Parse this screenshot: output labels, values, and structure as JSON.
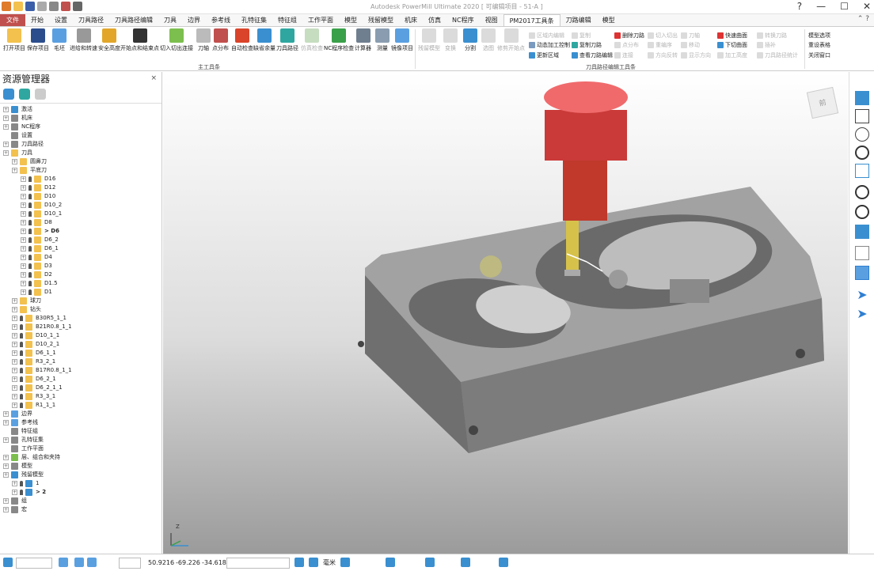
{
  "window": {
    "title": "Autodesk PowerMill Ultimate 2020  [ 可编辑项目 - 51-A ]",
    "help_glyph": "?",
    "min_glyph": "—",
    "max_glyph": "☐",
    "close_glyph": "✕"
  },
  "ribbon_tabs": [
    {
      "label": "文件"
    },
    {
      "label": "开始"
    },
    {
      "label": "设置"
    },
    {
      "label": "刀具路径"
    },
    {
      "label": "刀具路径编辑"
    },
    {
      "label": "刀具"
    },
    {
      "label": "边界"
    },
    {
      "label": "参考线"
    },
    {
      "label": "孔特征集"
    },
    {
      "label": "特征组"
    },
    {
      "label": "工作平面"
    },
    {
      "label": "模型"
    },
    {
      "label": "残留模型"
    },
    {
      "label": "机床"
    },
    {
      "label": "仿真"
    },
    {
      "label": "NC程序"
    },
    {
      "label": "视图"
    },
    {
      "label": "PM2017工具条"
    },
    {
      "label": "刀路编辑"
    },
    {
      "label": "模型"
    }
  ],
  "ribbon": {
    "group_main_label": "主工具条",
    "group_edit_label": "刀具路径编辑工具条",
    "main_buttons": [
      {
        "label": "打开项目"
      },
      {
        "label": "保存项目"
      },
      {
        "label": "毛坯"
      },
      {
        "label": "进给和转速"
      },
      {
        "label": "安全高度"
      },
      {
        "label": "开始点和结束点"
      },
      {
        "label": "切入切出连接"
      },
      {
        "label": "刀轴"
      },
      {
        "label": "点分布"
      },
      {
        "label": "自动检查"
      },
      {
        "label": "缺省余量"
      },
      {
        "label": "刀具路径"
      },
      {
        "label": "仿真检查"
      },
      {
        "label": "NC程序检查"
      },
      {
        "label": "计算器"
      },
      {
        "label": "测量"
      },
      {
        "label": "镜像项目"
      }
    ],
    "edit_buttons": [
      {
        "label": "残留模型"
      },
      {
        "label": "变换"
      },
      {
        "label": "分割"
      },
      {
        "label": "选图"
      },
      {
        "label": "修剪开始点"
      }
    ],
    "small_items": [
      {
        "label": "区域内编辑"
      },
      {
        "label": "动态加工控制"
      },
      {
        "label": "更新区域"
      },
      {
        "label": "复制"
      },
      {
        "label": "复制刀路"
      },
      {
        "label": "查看刀路编辑"
      },
      {
        "label": "删除刀路"
      },
      {
        "label": "切入切出"
      },
      {
        "label": "刀轴"
      },
      {
        "label": "点分布"
      },
      {
        "label": "重编序"
      },
      {
        "label": "移动"
      },
      {
        "label": "连接"
      },
      {
        "label": "方向反转"
      },
      {
        "label": "显示方向"
      },
      {
        "label": "快速曲面"
      },
      {
        "label": "下切曲面"
      },
      {
        "label": "加工高度"
      },
      {
        "label": "转换刀路"
      },
      {
        "label": "插补"
      },
      {
        "label": "刀具路径统计"
      },
      {
        "label": "模型选项"
      },
      {
        "label": "重设表格"
      },
      {
        "label": "关闭窗口"
      }
    ]
  },
  "explorer": {
    "title": "资源管理器",
    "close_glyph": "×",
    "tree": [
      {
        "label": "激活"
      },
      {
        "label": "机床"
      },
      {
        "label": "NC程序"
      },
      {
        "label": "设置"
      },
      {
        "label": "刀具路径"
      },
      {
        "label": "刀具"
      },
      {
        "label": "圆鼻刀"
      },
      {
        "label": "平底刀"
      },
      {
        "label": "D16"
      },
      {
        "label": "D12"
      },
      {
        "label": "D10"
      },
      {
        "label": "D10_2"
      },
      {
        "label": "D10_1"
      },
      {
        "label": "D8"
      },
      {
        "label": "> D6"
      },
      {
        "label": "D6_2"
      },
      {
        "label": "D6_1"
      },
      {
        "label": "D4"
      },
      {
        "label": "D3"
      },
      {
        "label": "D2"
      },
      {
        "label": "D1.5"
      },
      {
        "label": "D1"
      },
      {
        "label": "球刀"
      },
      {
        "label": "钻头"
      },
      {
        "label": "B30R5_1_1"
      },
      {
        "label": "B21R0.8_1_1"
      },
      {
        "label": "D10_1_1"
      },
      {
        "label": "D10_2_1"
      },
      {
        "label": "D6_1_1"
      },
      {
        "label": "R3_2_1"
      },
      {
        "label": "B17R0.8_1_1"
      },
      {
        "label": "D6_2_1"
      },
      {
        "label": "D6_2_1_1"
      },
      {
        "label": "R3_3_1"
      },
      {
        "label": "R1_1_1"
      },
      {
        "label": "边界"
      },
      {
        "label": "参考线"
      },
      {
        "label": "特征组"
      },
      {
        "label": "孔特征集"
      },
      {
        "label": "工作平面"
      },
      {
        "label": "层、组合和夹持"
      },
      {
        "label": "模型"
      },
      {
        "label": "残留模型"
      },
      {
        "label": "1"
      },
      {
        "label": "> 2"
      },
      {
        "label": "组"
      },
      {
        "label": "宏"
      }
    ]
  },
  "viewport": {
    "axis_x": "X",
    "axis_y": "Y",
    "axis_z": "Z",
    "viewcube_face": "前"
  },
  "statusbar": {
    "coord_x": "50.9216",
    "coord_y": "-69.226",
    "coord_z": "-34.618",
    "unit": "毫米"
  },
  "colors": {
    "file_tab": "#c0504d",
    "holder": "#e8686a",
    "shank": "#c0392b",
    "tool_tip": "#d6c24a",
    "part": "#8a8a8a",
    "accent_blue": "#2f7fd1"
  }
}
